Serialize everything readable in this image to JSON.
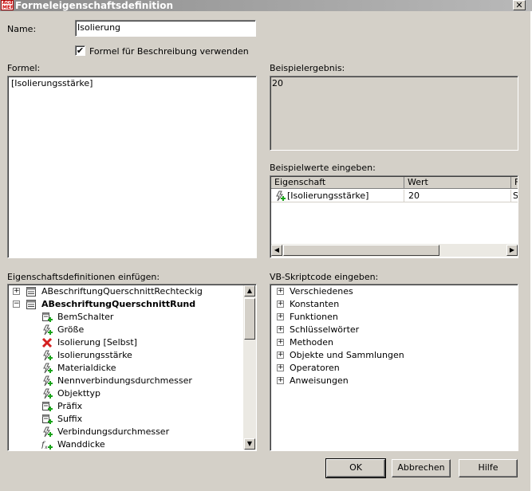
{
  "window": {
    "title": "Formeleigenschaftsdefinition",
    "icon_text": "Acd MEP",
    "close_glyph": "✕"
  },
  "name": {
    "label": "Name:",
    "value": "Isolierung"
  },
  "use_for_description": {
    "label": "Formel für Beschreibung verwenden",
    "checked": true,
    "glyph": "✔"
  },
  "formula": {
    "label": "Formel:",
    "value": "[Isolierungsstärke]"
  },
  "sample_result": {
    "label": "Beispielergebnis:",
    "value": "20"
  },
  "sample_values": {
    "label": "Beispielwerte eingeben:",
    "columns": [
      "Eigenschaft",
      "Wert",
      "F"
    ],
    "rows": [
      {
        "icon": "formula-property-icon",
        "property": "[Isolierungsstärke]",
        "value": "20",
        "extra": "S"
      }
    ]
  },
  "property_definitions": {
    "label": "Eigenschaftsdefinitionen einfügen:",
    "items": [
      {
        "text": "ABeschriftungQuerschnittRechteckig",
        "icon": "property-set-icon",
        "expander": "+",
        "level": 0,
        "bold": false
      },
      {
        "text": "ABeschriftungQuerschnittRund",
        "icon": "property-set-icon",
        "expander": "−",
        "level": 0,
        "bold": true
      },
      {
        "text": "BemSchalter",
        "icon": "manual-property-icon",
        "level": 1
      },
      {
        "text": "Größe",
        "icon": "automatic-property-icon",
        "level": 1
      },
      {
        "text": "Isolierung [Selbst]",
        "icon": "error-x-icon",
        "level": 1
      },
      {
        "text": "Isolierungsstärke",
        "icon": "automatic-property-icon",
        "level": 1
      },
      {
        "text": "Materialdicke",
        "icon": "automatic-property-icon",
        "level": 1
      },
      {
        "text": "Nennverbindungsdurchmesser",
        "icon": "automatic-property-icon",
        "level": 1
      },
      {
        "text": "Objekttyp",
        "icon": "automatic-property-icon",
        "level": 1
      },
      {
        "text": "Präfix",
        "icon": "manual-property-icon",
        "level": 1
      },
      {
        "text": "Suffix",
        "icon": "manual-property-icon",
        "level": 1
      },
      {
        "text": "Verbindungsdurchmesser",
        "icon": "automatic-property-icon",
        "level": 1
      },
      {
        "text": "Wanddicke",
        "icon": "formula-property-icon",
        "level": 1
      }
    ]
  },
  "vbscript": {
    "label": "VB-Skriptcode eingeben:",
    "items": [
      "Verschiedenes",
      "Konstanten",
      "Funktionen",
      "Schlüsselwörter",
      "Methoden",
      "Objekte und Sammlungen",
      "Operatoren",
      "Anweisungen"
    ]
  },
  "buttons": {
    "ok": "OK",
    "cancel": "Abbrechen",
    "help": "Hilfe"
  },
  "scroll_glyphs": {
    "up": "▲",
    "down": "▼",
    "left": "◀",
    "right": "▶"
  },
  "colors": {
    "dialog": "#d4d0c8",
    "field": "#ffffff",
    "error": "#d42020",
    "add_badge": "#1aa31a"
  }
}
